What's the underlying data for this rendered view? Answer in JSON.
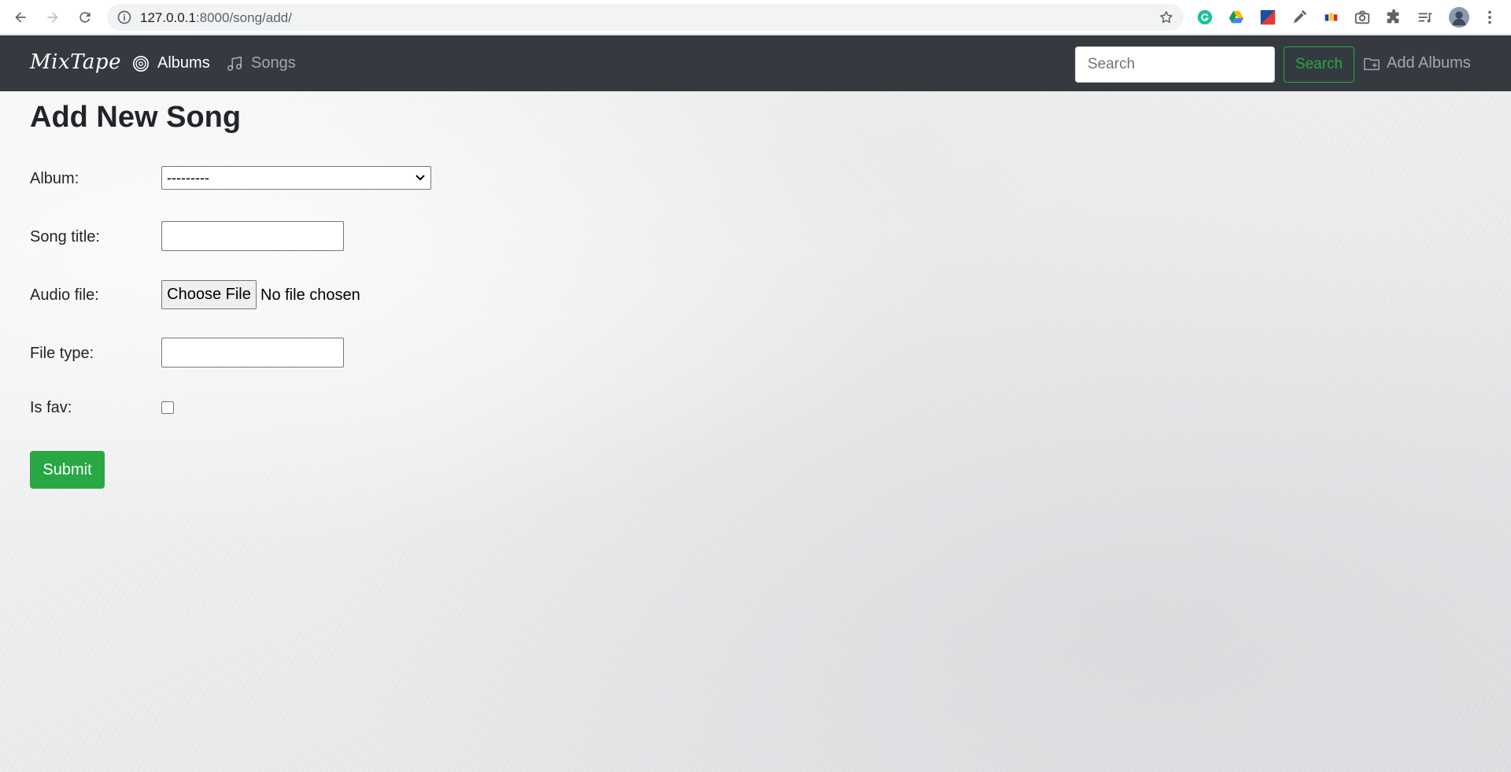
{
  "browser": {
    "url_host": "127.0.0.1",
    "url_rest": ":8000/song/add/",
    "extensions": [
      "grammarly-icon",
      "google-drive-icon",
      "extension-flag-icon",
      "eyedropper-icon",
      "color-extension-icon",
      "camera-icon",
      "puzzle-icon",
      "playlist-icon",
      "profile-avatar"
    ]
  },
  "navbar": {
    "brand": "MixTape",
    "albums_label": "Albums",
    "songs_label": "Songs",
    "search_placeholder": "Search",
    "search_button": "Search",
    "add_albums_label": "Add Albums"
  },
  "form": {
    "title": "Add New Song",
    "album_label": "Album:",
    "album_selected": "---------",
    "song_title_label": "Song title:",
    "song_title_value": "",
    "audio_file_label": "Audio file:",
    "choose_file_label": "Choose File",
    "file_status": "No file chosen",
    "file_type_label": "File type:",
    "file_type_value": "",
    "is_fav_label": "Is fav:",
    "is_fav_checked": false,
    "submit_label": "Submit"
  },
  "colors": {
    "navbar_bg": "#343a40",
    "success": "#28a745"
  }
}
